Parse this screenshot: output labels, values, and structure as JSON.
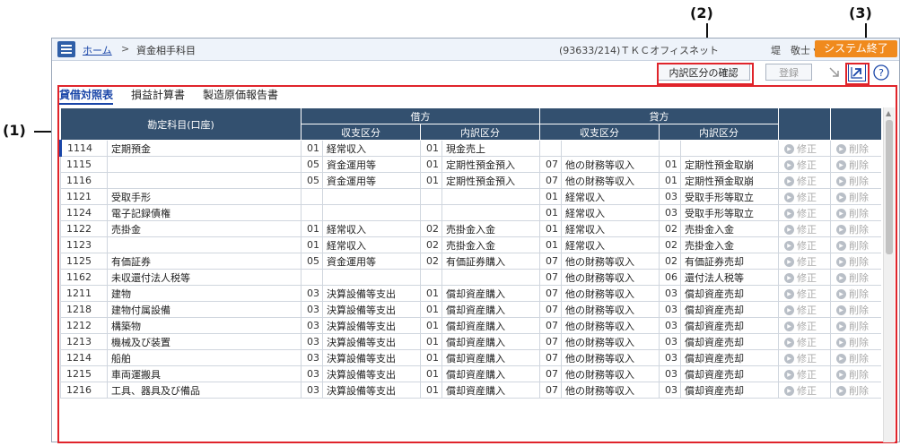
{
  "annotations": {
    "a1": "(1)",
    "a2": "(2)",
    "a3": "(3)"
  },
  "header": {
    "breadcrumb_home": "ホーム",
    "breadcrumb_sep": ">",
    "breadcrumb_current": "資金相手科目",
    "user_info": "(93633/214)ＴＫＣオフィスネット",
    "user_name": "堤　敬士 ▾",
    "exit_label": "システム終了"
  },
  "toolbar": {
    "breakdown_label": "内訳区分の確認",
    "register_label": "登録"
  },
  "tabs": [
    "貸借対照表",
    "損益計算書",
    "製造原価報告書"
  ],
  "table": {
    "header_account": "勘定科目(口座)",
    "header_debit": "借方",
    "header_credit": "貸方",
    "sub_cashflow": "収支区分",
    "sub_breakdown": "内訳区分",
    "fix_label": "修正",
    "del_label": "削除",
    "rows": [
      {
        "code": "1114",
        "name": "定期預金",
        "dc1": "01",
        "dn1": "経常収入",
        "dc2": "01",
        "dn2": "現金売上",
        "cc1": "",
        "cn1": "",
        "cc2": "",
        "cn2": ""
      },
      {
        "code": "1115",
        "name": "",
        "dc1": "05",
        "dn1": "資金運用等",
        "dc2": "01",
        "dn2": "定期性預金預入",
        "cc1": "07",
        "cn1": "他の財務等収入",
        "cc2": "01",
        "cn2": "定期性預金取崩"
      },
      {
        "code": "1116",
        "name": "",
        "dc1": "05",
        "dn1": "資金運用等",
        "dc2": "01",
        "dn2": "定期性預金預入",
        "cc1": "07",
        "cn1": "他の財務等収入",
        "cc2": "01",
        "cn2": "定期性預金取崩"
      },
      {
        "code": "1121",
        "name": "受取手形",
        "dc1": "",
        "dn1": "",
        "dc2": "",
        "dn2": "",
        "cc1": "01",
        "cn1": "経常収入",
        "cc2": "03",
        "cn2": "受取手形等取立"
      },
      {
        "code": "1124",
        "name": "電子記録債権",
        "dc1": "",
        "dn1": "",
        "dc2": "",
        "dn2": "",
        "cc1": "01",
        "cn1": "経常収入",
        "cc2": "03",
        "cn2": "受取手形等取立"
      },
      {
        "code": "1122",
        "name": "売掛金",
        "dc1": "01",
        "dn1": "経常収入",
        "dc2": "02",
        "dn2": "売掛金入金",
        "cc1": "01",
        "cn1": "経常収入",
        "cc2": "02",
        "cn2": "売掛金入金"
      },
      {
        "code": "1123",
        "name": "",
        "dc1": "01",
        "dn1": "経常収入",
        "dc2": "02",
        "dn2": "売掛金入金",
        "cc1": "01",
        "cn1": "経常収入",
        "cc2": "02",
        "cn2": "売掛金入金"
      },
      {
        "code": "1125",
        "name": "有価証券",
        "dc1": "05",
        "dn1": "資金運用等",
        "dc2": "02",
        "dn2": "有価証券購入",
        "cc1": "07",
        "cn1": "他の財務等収入",
        "cc2": "02",
        "cn2": "有価証券売却"
      },
      {
        "code": "1162",
        "name": "未収還付法人税等",
        "dc1": "",
        "dn1": "",
        "dc2": "",
        "dn2": "",
        "cc1": "07",
        "cn1": "他の財務等収入",
        "cc2": "06",
        "cn2": "還付法人税等"
      },
      {
        "code": "1211",
        "name": "建物",
        "dc1": "03",
        "dn1": "決算設備等支出",
        "dc2": "01",
        "dn2": "償却資産購入",
        "cc1": "07",
        "cn1": "他の財務等収入",
        "cc2": "03",
        "cn2": "償却資産売却"
      },
      {
        "code": "1218",
        "name": "建物付属設備",
        "dc1": "03",
        "dn1": "決算設備等支出",
        "dc2": "01",
        "dn2": "償却資産購入",
        "cc1": "07",
        "cn1": "他の財務等収入",
        "cc2": "03",
        "cn2": "償却資産売却"
      },
      {
        "code": "1212",
        "name": "構築物",
        "dc1": "03",
        "dn1": "決算設備等支出",
        "dc2": "01",
        "dn2": "償却資産購入",
        "cc1": "07",
        "cn1": "他の財務等収入",
        "cc2": "03",
        "cn2": "償却資産売却"
      },
      {
        "code": "1213",
        "name": "機械及び装置",
        "dc1": "03",
        "dn1": "決算設備等支出",
        "dc2": "01",
        "dn2": "償却資産購入",
        "cc1": "07",
        "cn1": "他の財務等収入",
        "cc2": "03",
        "cn2": "償却資産売却"
      },
      {
        "code": "1214",
        "name": "船舶",
        "dc1": "03",
        "dn1": "決算設備等支出",
        "dc2": "01",
        "dn2": "償却資産購入",
        "cc1": "07",
        "cn1": "他の財務等収入",
        "cc2": "03",
        "cn2": "償却資産売却"
      },
      {
        "code": "1215",
        "name": "車両運搬具",
        "dc1": "03",
        "dn1": "決算設備等支出",
        "dc2": "01",
        "dn2": "償却資産購入",
        "cc1": "07",
        "cn1": "他の財務等収入",
        "cc2": "03",
        "cn2": "償却資産売却"
      },
      {
        "code": "1216",
        "name": "工具、器具及び備品",
        "dc1": "03",
        "dn1": "決算設備等支出",
        "dc2": "01",
        "dn2": "償却資産購入",
        "cc1": "07",
        "cn1": "他の財務等収入",
        "cc2": "03",
        "cn2": "償却資産売却"
      }
    ]
  }
}
